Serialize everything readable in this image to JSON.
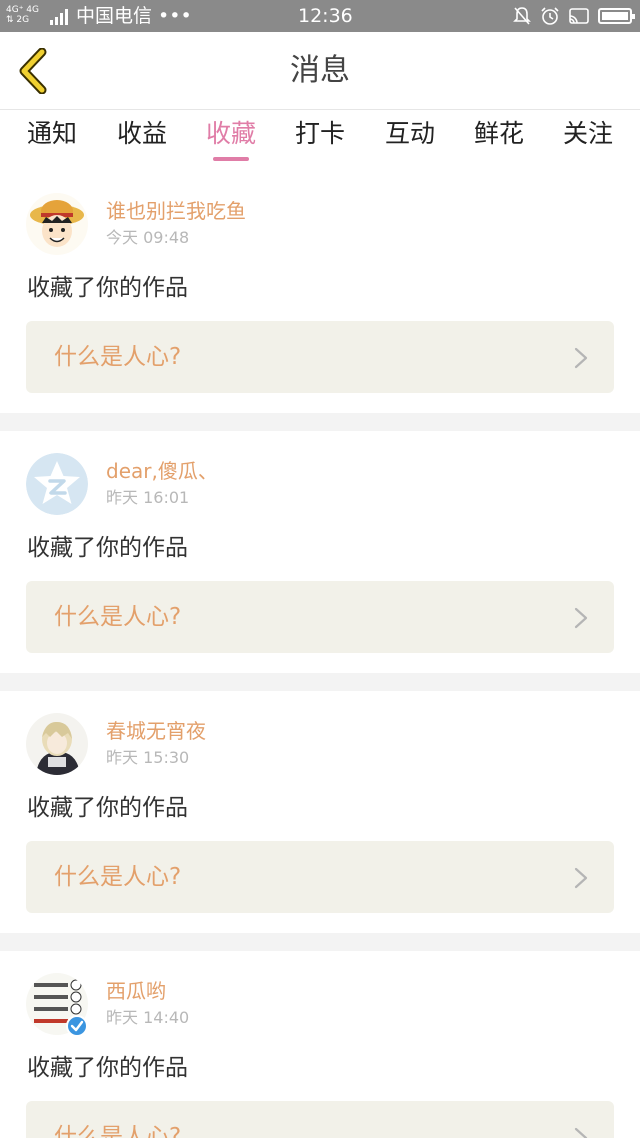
{
  "status_bar": {
    "network_top": "4G⁺ 4G",
    "network_bottom": "⇅ 2G",
    "carrier": "中国电信 •••",
    "time": "12:36"
  },
  "header": {
    "title": "消息",
    "back_icon": "chevron-left-icon",
    "accent_color": "#f0d030"
  },
  "tabs": [
    {
      "label": "通知",
      "active": false
    },
    {
      "label": "收益",
      "active": false
    },
    {
      "label": "收藏",
      "active": true
    },
    {
      "label": "打卡",
      "active": false
    },
    {
      "label": "互动",
      "active": false
    },
    {
      "label": "鲜花",
      "active": false
    },
    {
      "label": "关注",
      "active": false
    }
  ],
  "colors": {
    "tab_active": "#e07da7",
    "username": "#e3a06b",
    "work_bg": "#f2f1e9",
    "separator": "#f3f3f3"
  },
  "items": [
    {
      "username": "谁也别拦我吃鱼",
      "time": "今天 09:48",
      "action": "收藏了你的作品",
      "work_title": "什么是人心?",
      "avatar": "cartoon-boy-avatar"
    },
    {
      "username": "dear,傻瓜、",
      "time": "昨天 16:01",
      "action": "收藏了你的作品",
      "work_title": "什么是人心?",
      "avatar": "default-star-avatar"
    },
    {
      "username": "春城无宵夜",
      "time": "昨天 15:30",
      "action": "收藏了你的作品",
      "work_title": "什么是人心?",
      "avatar": "anime-girl-avatar"
    },
    {
      "username": "西瓜哟",
      "time": "昨天 14:40",
      "action": "收藏了你的作品",
      "work_title": "什么是人心?",
      "avatar": "panda-meme-avatar",
      "verified": true
    }
  ]
}
